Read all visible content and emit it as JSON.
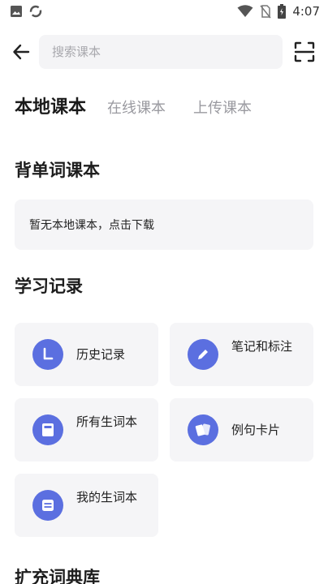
{
  "status_bar": {
    "time": "4:07",
    "left_icons": [
      "image-icon",
      "sync-icon"
    ],
    "right_icons": [
      "wifi-icon",
      "no-sim-icon",
      "battery-icon"
    ]
  },
  "header": {
    "search_placeholder": "搜索课本",
    "back_icon": "arrow-left-icon",
    "scan_icon": "scan-icon"
  },
  "tabs": [
    {
      "label": "本地课本",
      "active": true
    },
    {
      "label": "在线课本",
      "active": false
    },
    {
      "label": "上传课本",
      "active": false
    }
  ],
  "sections": {
    "wordbooks": {
      "title": "背单词课本",
      "empty_text": "暂无本地课本，点击下载"
    },
    "records": {
      "title": "学习记录",
      "items": [
        {
          "label": "历史记录",
          "icon": "clock-icon"
        },
        {
          "label": "笔记和标注",
          "icon": "pencil-icon"
        },
        {
          "label": "所有生词本",
          "icon": "notebook-icon"
        },
        {
          "label": "例句卡片",
          "icon": "cards-icon"
        },
        {
          "label": "我的生词本",
          "icon": "list-icon"
        }
      ]
    },
    "dictionary": {
      "title": "扩充词典库"
    }
  },
  "colors": {
    "accent": "#5b6fe0",
    "card_bg": "#f5f5f7",
    "search_bg": "#f4f4f6"
  }
}
